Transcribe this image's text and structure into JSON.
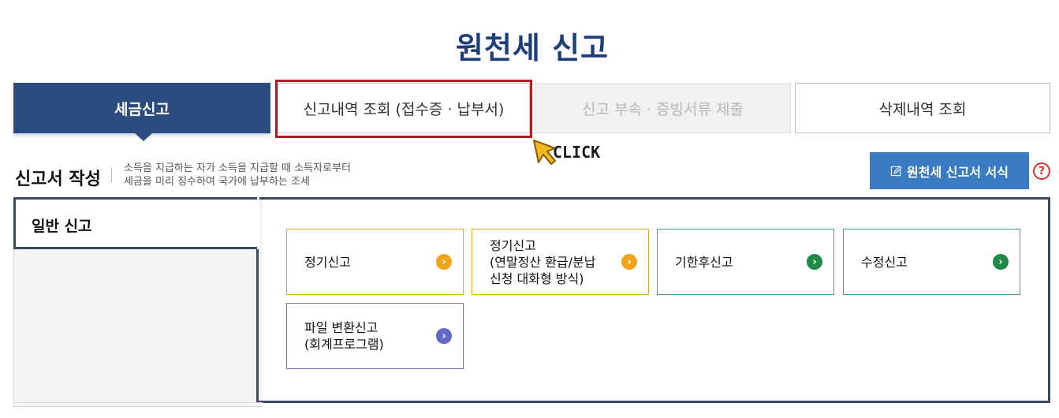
{
  "page": {
    "title": "원천세 신고"
  },
  "tabs": [
    {
      "label": "세금신고"
    },
    {
      "label": "신고내역 조회 (접수증 · 납부서)"
    },
    {
      "label": "신고 부속 · 증빙서류 제출"
    },
    {
      "label": "삭제내역 조회"
    }
  ],
  "annotation": {
    "click_label": "CLICK",
    "cursor_icon": "pointer-cursor-icon",
    "highlight_color": "#b01e23"
  },
  "section": {
    "title": "신고서 작성",
    "description_line1": "소득을 지급하는 자가 소득을 지급할 때 소득자로부터",
    "description_line2": "세금을 미리 징수하여 국가에 납부하는 조세"
  },
  "form_button": {
    "label": "원천세 신고서 서식",
    "icon": "edit-icon"
  },
  "help": {
    "label": "?"
  },
  "panel": {
    "tab_label": "일반 신고",
    "cards": [
      {
        "lines": [
          "정기신고"
        ],
        "color": "#f3a21b"
      },
      {
        "lines": [
          "정기신고",
          "(연말정산 환급/분납",
          "신청 대화형 방식)"
        ],
        "color": "#f3a21b"
      },
      {
        "lines": [
          "기한후신고"
        ],
        "color": "#1f8a45"
      },
      {
        "lines": [
          "수정신고"
        ],
        "color": "#1f8a45"
      },
      {
        "lines": [
          "파일 변환신고",
          "(회계프로그램)"
        ],
        "color": "#6368c4"
      }
    ],
    "chevron": "›"
  },
  "colors": {
    "primary": "#2b4c7e",
    "title": "#1d3e7a",
    "button": "#3a7cc3"
  }
}
